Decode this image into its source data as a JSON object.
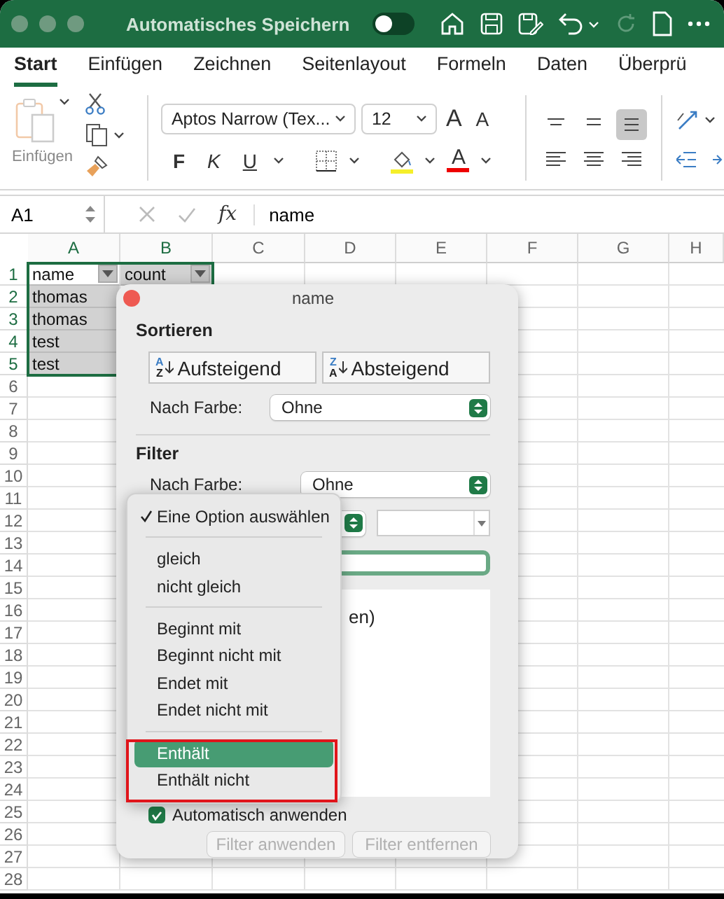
{
  "window": {
    "title": "Automatisches Speichern",
    "autosave_on": false
  },
  "ribbon_tabs": [
    {
      "label": "Start",
      "selected": true
    },
    {
      "label": "Einfügen",
      "selected": false
    },
    {
      "label": "Zeichnen",
      "selected": false
    },
    {
      "label": "Seitenlayout",
      "selected": false
    },
    {
      "label": "Formeln",
      "selected": false
    },
    {
      "label": "Daten",
      "selected": false
    },
    {
      "label": "Überprü",
      "selected": false
    }
  ],
  "clipboard": {
    "paste_label": "Einfügen"
  },
  "font": {
    "name": "Aptos Narrow (Tex...",
    "size": "12",
    "grow": "A",
    "shrink": "A",
    "bold": "F",
    "italic": "K",
    "underline": "U",
    "font_color": "A"
  },
  "alignment": [
    {
      "selected": false
    },
    {
      "selected": false
    },
    {
      "selected": true
    }
  ],
  "formula_bar": {
    "cell": "A1",
    "fx": "fx",
    "value": "name"
  },
  "sheet": {
    "columns": [
      {
        "label": "A",
        "selected": true
      },
      {
        "label": "B",
        "selected": true
      },
      {
        "label": "C",
        "selected": false
      },
      {
        "label": "D",
        "selected": false
      },
      {
        "label": "E",
        "selected": false
      },
      {
        "label": "F",
        "selected": false
      },
      {
        "label": "G",
        "selected": false
      },
      {
        "label": "H",
        "selected": false
      }
    ],
    "rows": [
      {
        "number": "1",
        "selected": true,
        "cells": [
          {
            "text": "name",
            "active": true,
            "filter_button": true
          },
          {
            "text": "count",
            "active": false,
            "filter_button": true
          }
        ]
      },
      {
        "number": "2",
        "selected": true,
        "cells": [
          {
            "text": "thomas",
            "active": false,
            "filter_button": false
          }
        ]
      },
      {
        "number": "3",
        "selected": true,
        "cells": [
          {
            "text": "thomas",
            "active": false,
            "filter_button": false
          }
        ]
      },
      {
        "number": "4",
        "selected": true,
        "cells": [
          {
            "text": "test",
            "active": false,
            "filter_button": false
          }
        ]
      },
      {
        "number": "5",
        "selected": true,
        "cells": [
          {
            "text": "test",
            "active": false,
            "filter_button": false
          }
        ]
      },
      {
        "number": "6",
        "selected": false
      },
      {
        "number": "7",
        "selected": false
      },
      {
        "number": "8",
        "selected": false
      },
      {
        "number": "9",
        "selected": false
      },
      {
        "number": "10",
        "selected": false
      },
      {
        "number": "11",
        "selected": false
      },
      {
        "number": "12",
        "selected": false
      },
      {
        "number": "13",
        "selected": false
      },
      {
        "number": "14",
        "selected": false
      },
      {
        "number": "15",
        "selected": false
      },
      {
        "number": "16",
        "selected": false
      },
      {
        "number": "17",
        "selected": false
      },
      {
        "number": "18",
        "selected": false
      },
      {
        "number": "19",
        "selected": false
      },
      {
        "number": "20",
        "selected": false
      },
      {
        "number": "21",
        "selected": false
      },
      {
        "number": "22",
        "selected": false
      },
      {
        "number": "23",
        "selected": false
      },
      {
        "number": "24",
        "selected": false
      },
      {
        "number": "25",
        "selected": false
      },
      {
        "number": "26",
        "selected": false
      },
      {
        "number": "27",
        "selected": false
      },
      {
        "number": "28",
        "selected": false
      }
    ]
  },
  "filter_popup": {
    "title": "name",
    "sort_heading": "Sortieren",
    "sort_buttons": [
      {
        "label": "Aufsteigend",
        "icon_letters": [
          "A",
          "Z"
        ]
      },
      {
        "label": "Absteigend",
        "icon_letters": [
          "Z",
          "A"
        ]
      }
    ],
    "sort_color_label": "Nach Farbe:",
    "sort_color_value": "Ohne",
    "filter_heading": "Filter",
    "filter_color_label": "Nach Farbe:",
    "filter_color_value": "Ohne",
    "list_items": [
      "en)"
    ],
    "auto_apply": {
      "label": "Automatisch anwenden",
      "checked": true
    },
    "buttons": [
      {
        "label": "Filter anwenden",
        "disabled": true
      },
      {
        "label": "Filter entfernen",
        "disabled": true
      }
    ]
  },
  "operator_menu": {
    "groups": [
      [
        {
          "label": "Eine Option auswählen",
          "checked": true,
          "highlighted": false
        }
      ],
      [
        {
          "label": "gleich",
          "checked": false,
          "highlighted": false
        },
        {
          "label": "nicht gleich",
          "checked": false,
          "highlighted": false
        }
      ],
      [
        {
          "label": "Beginnt mit",
          "checked": false,
          "highlighted": false
        },
        {
          "label": "Beginnt nicht mit",
          "checked": false,
          "highlighted": false
        },
        {
          "label": "Endet mit",
          "checked": false,
          "highlighted": false
        },
        {
          "label": "Endet nicht mit",
          "checked": false,
          "highlighted": false
        }
      ],
      [
        {
          "label": "Enthält",
          "checked": false,
          "highlighted": true
        },
        {
          "label": "Enthält nicht",
          "checked": false,
          "highlighted": false
        }
      ]
    ]
  }
}
